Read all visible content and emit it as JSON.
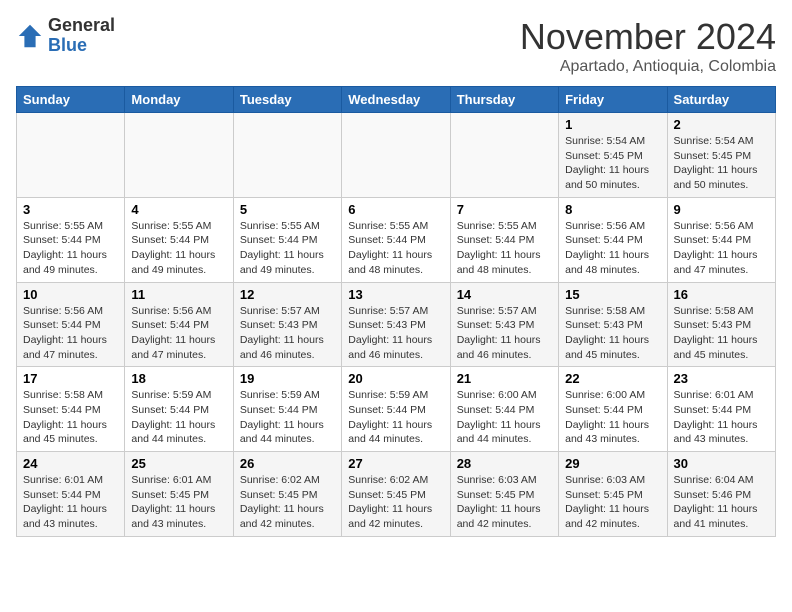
{
  "header": {
    "logo_general": "General",
    "logo_blue": "Blue",
    "month": "November 2024",
    "location": "Apartado, Antioquia, Colombia"
  },
  "weekdays": [
    "Sunday",
    "Monday",
    "Tuesday",
    "Wednesday",
    "Thursday",
    "Friday",
    "Saturday"
  ],
  "weeks": [
    [
      {
        "day": "",
        "info": ""
      },
      {
        "day": "",
        "info": ""
      },
      {
        "day": "",
        "info": ""
      },
      {
        "day": "",
        "info": ""
      },
      {
        "day": "",
        "info": ""
      },
      {
        "day": "1",
        "info": "Sunrise: 5:54 AM\nSunset: 5:45 PM\nDaylight: 11 hours\nand 50 minutes."
      },
      {
        "day": "2",
        "info": "Sunrise: 5:54 AM\nSunset: 5:45 PM\nDaylight: 11 hours\nand 50 minutes."
      }
    ],
    [
      {
        "day": "3",
        "info": "Sunrise: 5:55 AM\nSunset: 5:44 PM\nDaylight: 11 hours\nand 49 minutes."
      },
      {
        "day": "4",
        "info": "Sunrise: 5:55 AM\nSunset: 5:44 PM\nDaylight: 11 hours\nand 49 minutes."
      },
      {
        "day": "5",
        "info": "Sunrise: 5:55 AM\nSunset: 5:44 PM\nDaylight: 11 hours\nand 49 minutes."
      },
      {
        "day": "6",
        "info": "Sunrise: 5:55 AM\nSunset: 5:44 PM\nDaylight: 11 hours\nand 48 minutes."
      },
      {
        "day": "7",
        "info": "Sunrise: 5:55 AM\nSunset: 5:44 PM\nDaylight: 11 hours\nand 48 minutes."
      },
      {
        "day": "8",
        "info": "Sunrise: 5:56 AM\nSunset: 5:44 PM\nDaylight: 11 hours\nand 48 minutes."
      },
      {
        "day": "9",
        "info": "Sunrise: 5:56 AM\nSunset: 5:44 PM\nDaylight: 11 hours\nand 47 minutes."
      }
    ],
    [
      {
        "day": "10",
        "info": "Sunrise: 5:56 AM\nSunset: 5:44 PM\nDaylight: 11 hours\nand 47 minutes."
      },
      {
        "day": "11",
        "info": "Sunrise: 5:56 AM\nSunset: 5:44 PM\nDaylight: 11 hours\nand 47 minutes."
      },
      {
        "day": "12",
        "info": "Sunrise: 5:57 AM\nSunset: 5:43 PM\nDaylight: 11 hours\nand 46 minutes."
      },
      {
        "day": "13",
        "info": "Sunrise: 5:57 AM\nSunset: 5:43 PM\nDaylight: 11 hours\nand 46 minutes."
      },
      {
        "day": "14",
        "info": "Sunrise: 5:57 AM\nSunset: 5:43 PM\nDaylight: 11 hours\nand 46 minutes."
      },
      {
        "day": "15",
        "info": "Sunrise: 5:58 AM\nSunset: 5:43 PM\nDaylight: 11 hours\nand 45 minutes."
      },
      {
        "day": "16",
        "info": "Sunrise: 5:58 AM\nSunset: 5:43 PM\nDaylight: 11 hours\nand 45 minutes."
      }
    ],
    [
      {
        "day": "17",
        "info": "Sunrise: 5:58 AM\nSunset: 5:44 PM\nDaylight: 11 hours\nand 45 minutes."
      },
      {
        "day": "18",
        "info": "Sunrise: 5:59 AM\nSunset: 5:44 PM\nDaylight: 11 hours\nand 44 minutes."
      },
      {
        "day": "19",
        "info": "Sunrise: 5:59 AM\nSunset: 5:44 PM\nDaylight: 11 hours\nand 44 minutes."
      },
      {
        "day": "20",
        "info": "Sunrise: 5:59 AM\nSunset: 5:44 PM\nDaylight: 11 hours\nand 44 minutes."
      },
      {
        "day": "21",
        "info": "Sunrise: 6:00 AM\nSunset: 5:44 PM\nDaylight: 11 hours\nand 44 minutes."
      },
      {
        "day": "22",
        "info": "Sunrise: 6:00 AM\nSunset: 5:44 PM\nDaylight: 11 hours\nand 43 minutes."
      },
      {
        "day": "23",
        "info": "Sunrise: 6:01 AM\nSunset: 5:44 PM\nDaylight: 11 hours\nand 43 minutes."
      }
    ],
    [
      {
        "day": "24",
        "info": "Sunrise: 6:01 AM\nSunset: 5:44 PM\nDaylight: 11 hours\nand 43 minutes."
      },
      {
        "day": "25",
        "info": "Sunrise: 6:01 AM\nSunset: 5:45 PM\nDaylight: 11 hours\nand 43 minutes."
      },
      {
        "day": "26",
        "info": "Sunrise: 6:02 AM\nSunset: 5:45 PM\nDaylight: 11 hours\nand 42 minutes."
      },
      {
        "day": "27",
        "info": "Sunrise: 6:02 AM\nSunset: 5:45 PM\nDaylight: 11 hours\nand 42 minutes."
      },
      {
        "day": "28",
        "info": "Sunrise: 6:03 AM\nSunset: 5:45 PM\nDaylight: 11 hours\nand 42 minutes."
      },
      {
        "day": "29",
        "info": "Sunrise: 6:03 AM\nSunset: 5:45 PM\nDaylight: 11 hours\nand 42 minutes."
      },
      {
        "day": "30",
        "info": "Sunrise: 6:04 AM\nSunset: 5:46 PM\nDaylight: 11 hours\nand 41 minutes."
      }
    ]
  ]
}
